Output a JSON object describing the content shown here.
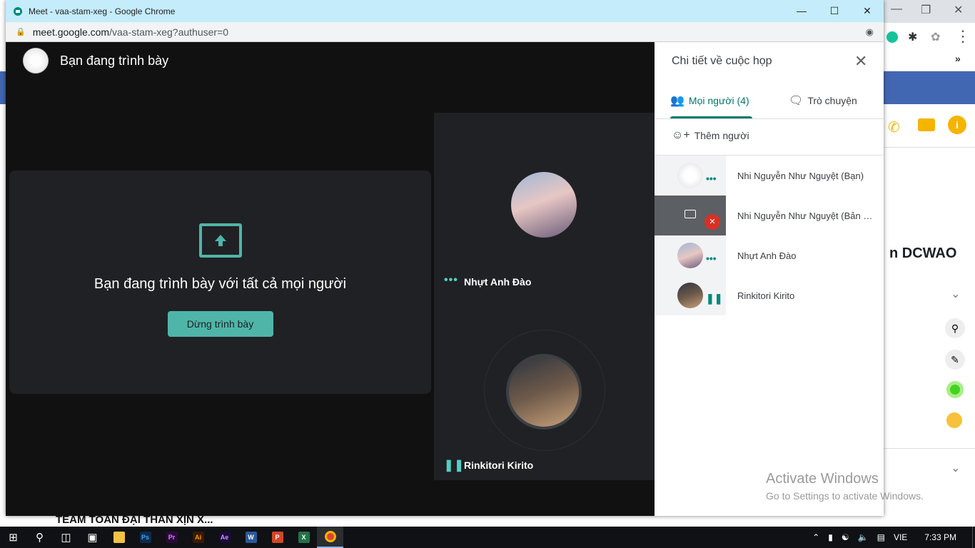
{
  "window": {
    "title": "Meet - vaa-stam-xeg - Google Chrome",
    "url_host": "meet.google.com",
    "url_path": "/vaa-stam-xeg?authuser=0"
  },
  "meet": {
    "header_title": "Bạn đang trình bày",
    "present_message": "Bạn đang trình bày với tất cả mọi người",
    "stop_button": "Dừng trình bày",
    "tiles": [
      {
        "name": "Nhựt Anh Đào"
      },
      {
        "name": "Rinkitori Kirito"
      }
    ]
  },
  "panel": {
    "title": "Chi tiết về cuộc họp",
    "tab_people": "Mọi người (4)",
    "tab_chat": "Trò chuyện",
    "add_person": "Thêm người",
    "participants": [
      {
        "name": "Nhi Nguyễn Như Nguyệt (Bạn)"
      },
      {
        "name": "Nhi Nguyễn Như Nguyệt (Bản trình bày)"
      },
      {
        "name": "Nhựt Anh Đào"
      },
      {
        "name": "Rinkitori Kirito"
      }
    ]
  },
  "background": {
    "page_title_partial": "n DCWAO",
    "team_label": "TEAM TOÁN ĐẠI THẦN XỊN X..."
  },
  "activate": {
    "line1": "Activate Windows",
    "line2": "Go to Settings to activate Windows."
  },
  "taskbar": {
    "lang": "VIE",
    "time": "7:33 PM"
  },
  "colors": {
    "accent_teal": "#4fb5a9",
    "meet_bg": "#111111",
    "panel_accent": "#00796b"
  }
}
